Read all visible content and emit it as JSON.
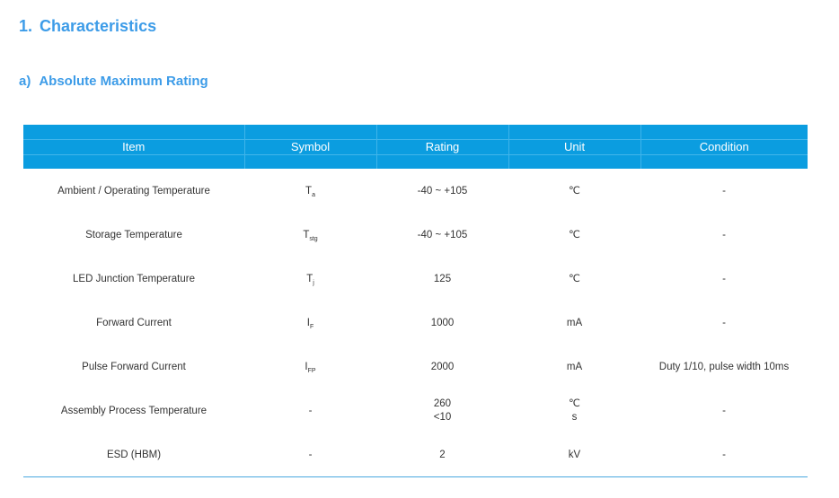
{
  "heading": {
    "number": "1.",
    "title": "Characteristics"
  },
  "subheading": {
    "number": "a)",
    "title": "Absolute Maximum Rating"
  },
  "table": {
    "headers": [
      "Item",
      "Symbol",
      "Rating",
      "Unit",
      "Condition"
    ],
    "rows": [
      {
        "item": "Ambient / Operating Temperature",
        "symbol_base": "T",
        "symbol_sub": "a",
        "rating": [
          "-40 ~ +105"
        ],
        "unit": [
          "℃"
        ],
        "condition": "-"
      },
      {
        "item": "Storage Temperature",
        "symbol_base": "T",
        "symbol_sub": "stg",
        "rating": [
          "-40 ~ +105"
        ],
        "unit": [
          "℃"
        ],
        "condition": "-"
      },
      {
        "item": "LED Junction Temperature",
        "symbol_base": "T",
        "symbol_sub": "j",
        "rating": [
          "125"
        ],
        "unit": [
          "℃"
        ],
        "condition": "-"
      },
      {
        "item": "Forward Current",
        "symbol_base": "I",
        "symbol_sub": "F",
        "rating": [
          "1000"
        ],
        "unit": [
          "mA"
        ],
        "condition": "-"
      },
      {
        "item": "Pulse Forward Current",
        "symbol_base": "I",
        "symbol_sub": "FP",
        "rating": [
          "2000"
        ],
        "unit": [
          "mA"
        ],
        "condition": "Duty 1/10, pulse width 10ms"
      },
      {
        "item": "Assembly Process Temperature",
        "symbol_base": "-",
        "symbol_sub": "",
        "rating": [
          "260",
          "<10"
        ],
        "unit": [
          "℃",
          "s"
        ],
        "condition": "-"
      },
      {
        "item": "ESD (HBM)",
        "symbol_base": "-",
        "symbol_sub": "",
        "rating": [
          "2"
        ],
        "unit": [
          "kV"
        ],
        "condition": "-"
      }
    ]
  },
  "colors": {
    "accent": "#3d9ce8",
    "header_bg": "#0b9de0",
    "text": "#333333"
  }
}
